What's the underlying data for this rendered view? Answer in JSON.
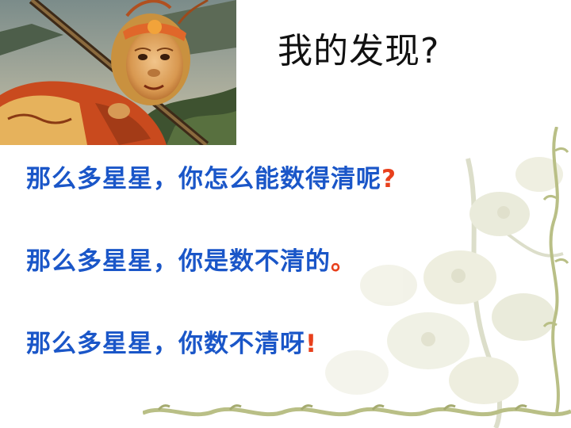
{
  "slide": {
    "title": "我的发现?",
    "lines": [
      {
        "text": "那么多星星，你怎么能数得清呢",
        "end": "?",
        "end_color": "#e8401c"
      },
      {
        "text": "那么多星星，你是数不清的",
        "end": "。",
        "end_color": "#e8401c"
      },
      {
        "text": "那么多星星，你数不清呀",
        "end": "!",
        "end_color": "#e8401c"
      }
    ]
  },
  "colors": {
    "text_blue": "#1a56c8",
    "accent_red": "#e8401c",
    "title_black": "#111111",
    "vine_green": "#b9bf86"
  },
  "images": {
    "photo": "monkey-king-photo",
    "background": "faded-floral-vine"
  }
}
